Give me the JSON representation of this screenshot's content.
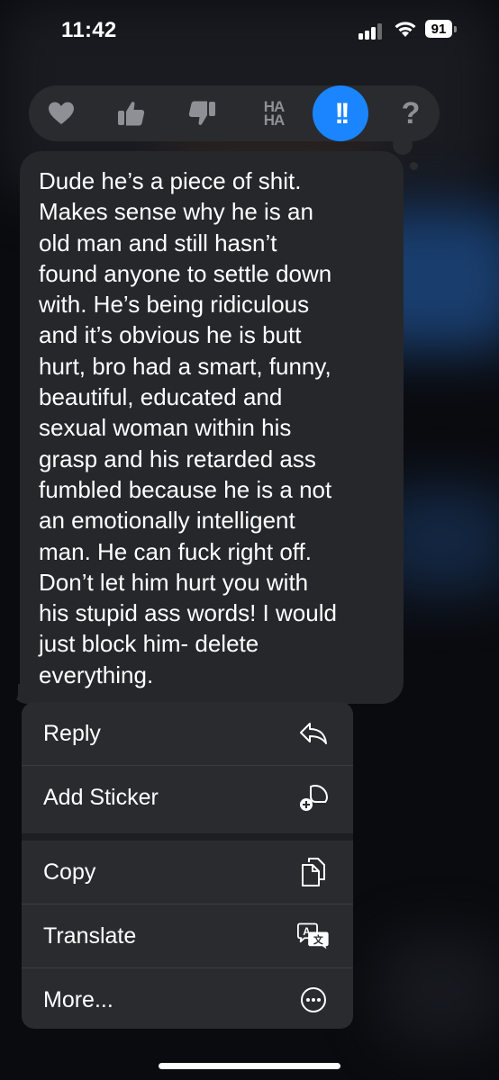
{
  "status_bar": {
    "time": "11:42",
    "battery_level": "91",
    "signal_icon": "cellular-signal-icon",
    "wifi_icon": "wifi-icon"
  },
  "reactions": [
    {
      "name": "heart",
      "icon": "heart-icon",
      "selected": false
    },
    {
      "name": "thumbs-up",
      "icon": "thumbs-up-icon",
      "selected": false
    },
    {
      "name": "thumbs-down",
      "icon": "thumbs-down-icon",
      "selected": false
    },
    {
      "name": "haha",
      "icon": "haha-icon",
      "label_top": "HA",
      "label_bottom": "HA",
      "selected": false
    },
    {
      "name": "emphasize",
      "icon": "double-exclamation-icon",
      "label": "!!",
      "selected": true
    },
    {
      "name": "question",
      "icon": "question-mark-icon",
      "label": "?",
      "selected": false
    }
  ],
  "message": {
    "text": "Dude he’s a piece of shit.\nMakes sense why he is an\nold man and still hasn’t\nfound anyone to settle down\nwith. He’s being ridiculous\nand it’s obvious he is butt\nhurt, bro had a smart, funny,\nbeautiful, educated and\nsexual woman within his\ngrasp and his retarded ass\nfumbled because he is a not\nan emotionally intelligent\nman. He can fuck right off.\nDon’t let him hurt you with\nhis stupid ass words! I would\njust block him- delete\neverything."
  },
  "menu": {
    "items": [
      {
        "label": "Reply",
        "icon": "reply-arrow-icon"
      },
      {
        "label": "Add Sticker",
        "icon": "add-sticker-icon"
      },
      {
        "label": "Copy",
        "icon": "copy-icon"
      },
      {
        "label": "Translate",
        "icon": "translate-icon"
      },
      {
        "label": "More...",
        "icon": "more-ellipsis-icon"
      }
    ]
  },
  "colors": {
    "accent": "#1b84ff",
    "bubble": "#26272b",
    "menu": "#2a2b2f",
    "inactive_icon": "#8f9096"
  }
}
